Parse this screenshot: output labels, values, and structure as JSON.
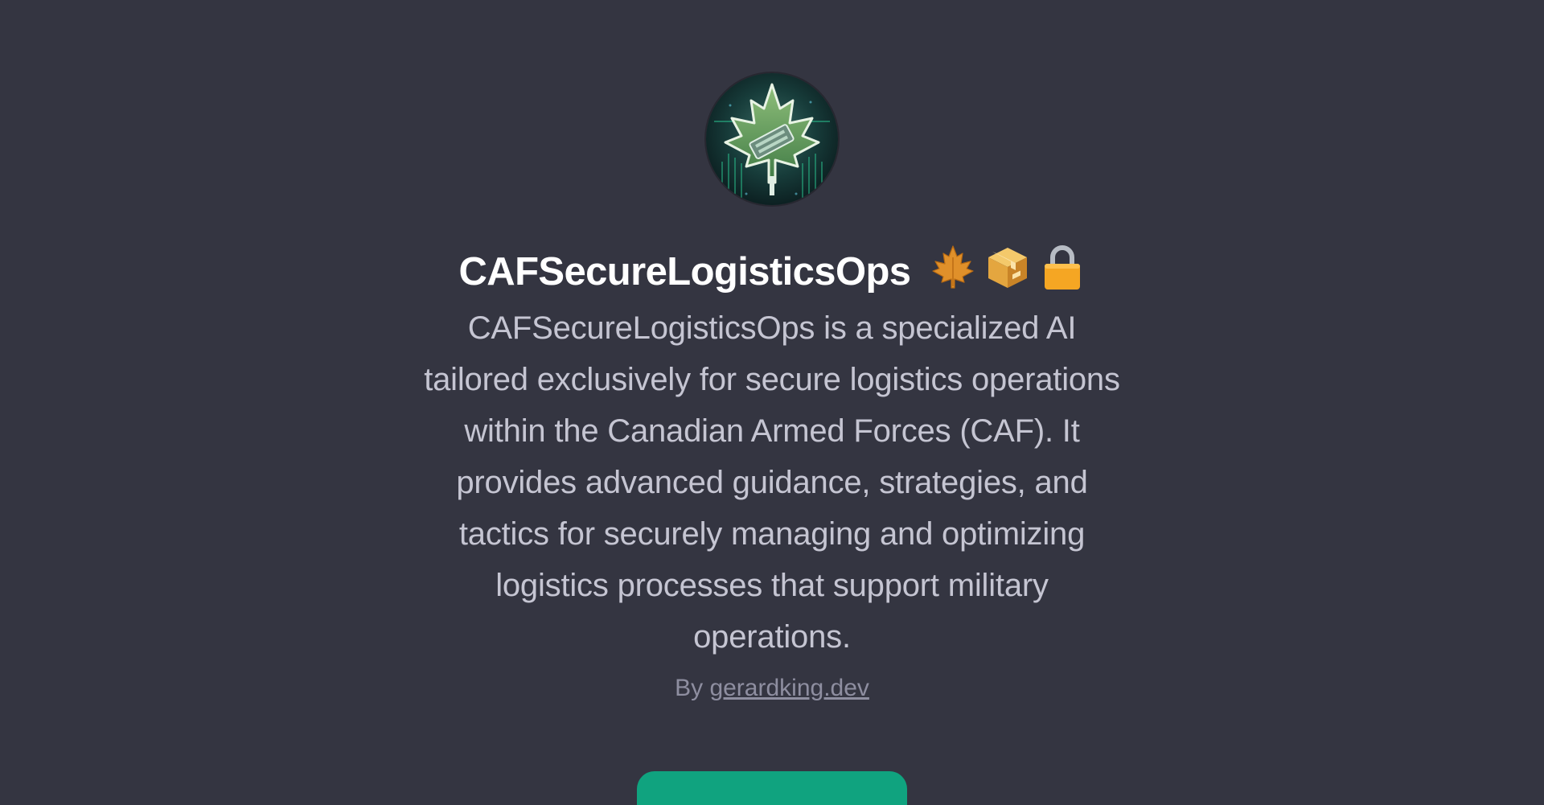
{
  "gpt": {
    "avatar_icon": "maple-leaf-circuit-icon",
    "title": "CAFSecureLogisticsOps",
    "title_emojis": [
      "maple-leaf-icon",
      "package-icon",
      "lock-icon"
    ],
    "description_lines": [
      "CAFSecureLogisticsOps is a specialized AI",
      "tailored exclusively for secure logistics operations",
      "within the Canadian Armed Forces (CAF). It",
      "provides advanced guidance, strategies, and",
      "tactics for securely managing and optimizing",
      "logistics processes that support military",
      "operations."
    ],
    "by_prefix": "By",
    "author": "gerardking.dev"
  },
  "colors": {
    "background": "#343541",
    "title": "#ffffff",
    "description": "#c5c5d2",
    "byline": "#8e8ea0",
    "accent": "#10a37f"
  }
}
